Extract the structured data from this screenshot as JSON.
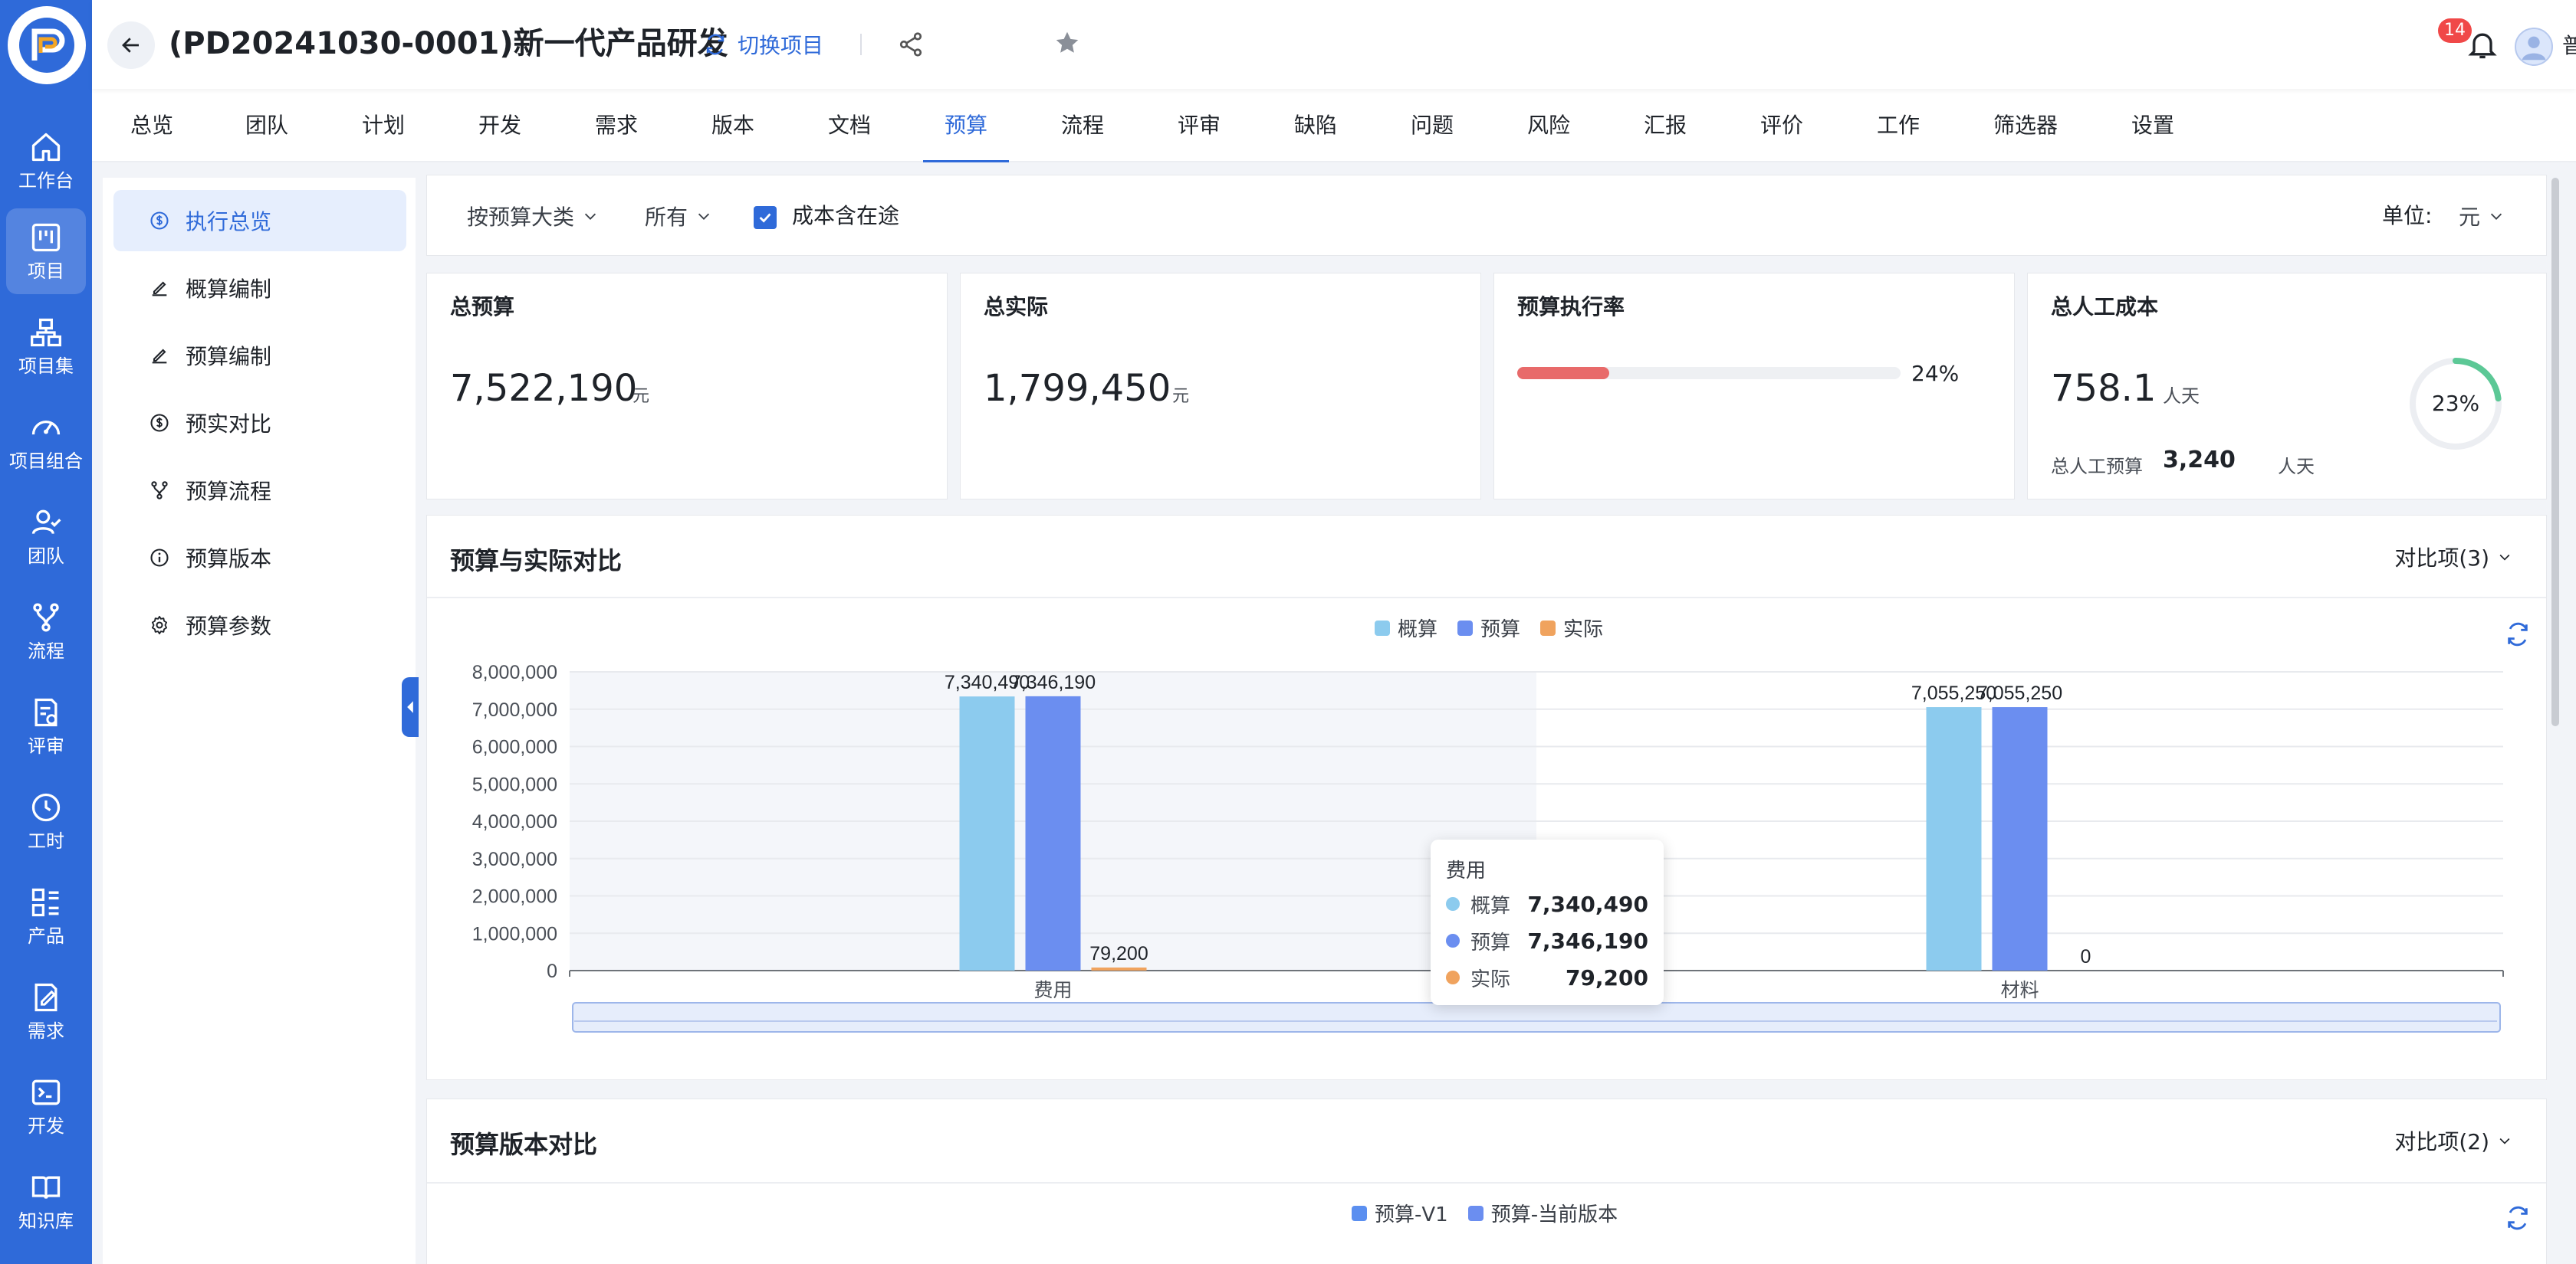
{
  "nav": {
    "items": [
      {
        "label": "工作台",
        "icon": "home-icon"
      },
      {
        "label": "项目",
        "icon": "kanban-icon"
      },
      {
        "label": "项目集",
        "icon": "hierarchy-icon"
      },
      {
        "label": "项目组合",
        "icon": "gauge-icon"
      },
      {
        "label": "团队",
        "icon": "team-icon"
      },
      {
        "label": "流程",
        "icon": "flow-icon"
      },
      {
        "label": "评审",
        "icon": "review-icon"
      },
      {
        "label": "工时",
        "icon": "clock-icon"
      },
      {
        "label": "产品",
        "icon": "product-icon"
      },
      {
        "label": "需求",
        "icon": "requirement-icon"
      },
      {
        "label": "开发",
        "icon": "terminal-icon"
      },
      {
        "label": "知识库",
        "icon": "book-icon"
      }
    ],
    "active_index": 1
  },
  "header": {
    "title": "(PD20241030-0001)新一代产品研发",
    "switch_label": "切换项目",
    "notification_count": "14",
    "user_name": "普明"
  },
  "tabs": {
    "items": [
      "总览",
      "团队",
      "计划",
      "开发",
      "需求",
      "版本",
      "文档",
      "预算",
      "流程",
      "评审",
      "缺陷",
      "问题",
      "风险",
      "汇报",
      "评价",
      "工作",
      "筛选器",
      "设置"
    ],
    "active_index": 7
  },
  "subnav": {
    "items": [
      {
        "label": "执行总览",
        "icon": "dollar-circle-icon"
      },
      {
        "label": "概算编制",
        "icon": "edit-icon"
      },
      {
        "label": "预算编制",
        "icon": "edit-icon"
      },
      {
        "label": "预实对比",
        "icon": "dollar-circle-icon"
      },
      {
        "label": "预算流程",
        "icon": "branch-icon"
      },
      {
        "label": "预算版本",
        "icon": "info-circle-icon"
      },
      {
        "label": "预算参数",
        "icon": "gear-icon"
      }
    ],
    "active_index": 0
  },
  "filters": {
    "group_by": "按预算大类",
    "scope": "所有",
    "cost_in_transit": "成本含在途",
    "cost_in_transit_checked": true,
    "unit_label": "单位:",
    "unit_value": "元"
  },
  "cards": {
    "total_budget": {
      "title": "总预算",
      "value": "7,522,190",
      "unit": "元"
    },
    "total_actual": {
      "title": "总实际",
      "value": "1,799,450",
      "unit": "元"
    },
    "execution_rate": {
      "title": "预算执行率",
      "value": "24%",
      "fraction": 0.24
    },
    "labor_cost": {
      "title": "总人工成本",
      "value": "758.1",
      "unit": "人天",
      "budget_label": "总人工预算",
      "budget_value": "3,240",
      "budget_unit": "人天",
      "ring_value": "23%",
      "ring_fraction": 0.23
    }
  },
  "budget_vs_actual": {
    "title": "预算与实际对比",
    "compare_label": "对比项(3)",
    "legend": [
      {
        "name": "概算",
        "color": "#8ccbee"
      },
      {
        "name": "预算",
        "color": "#6b8ef0"
      },
      {
        "name": "实际",
        "color": "#f0a35e"
      }
    ],
    "tooltip": {
      "title": "费用",
      "rows": [
        {
          "name": "概算",
          "value": "7,340,490",
          "color": "#8ccbee"
        },
        {
          "name": "预算",
          "value": "7,346,190",
          "color": "#6b8ef0"
        },
        {
          "name": "实际",
          "value": "79,200",
          "color": "#f0a35e"
        }
      ]
    }
  },
  "version_compare": {
    "title": "预算版本对比",
    "compare_label": "对比项(2)",
    "legend": [
      {
        "name": "预算-V1",
        "color": "#5b8ff0"
      },
      {
        "name": "预算-当前版本",
        "color": "#6b8ef0"
      }
    ]
  },
  "chart_data": {
    "type": "bar",
    "categories": [
      "费用",
      "材料"
    ],
    "series": [
      {
        "name": "概算",
        "values": [
          7340490,
          7055250
        ]
      },
      {
        "name": "预算",
        "values": [
          7346190,
          7055250
        ]
      },
      {
        "name": "实际",
        "values": [
          79200,
          0
        ]
      }
    ],
    "value_labels": [
      [
        "7,340,490",
        "7,055,250"
      ],
      [
        "7,346,190",
        "7,055,250"
      ],
      [
        "79,200",
        "0"
      ]
    ],
    "y_ticks": [
      "0",
      "1,000,000",
      "2,000,000",
      "3,000,000",
      "4,000,000",
      "5,000,000",
      "6,000,000",
      "7,000,000",
      "8,000,000"
    ],
    "ylim": [
      0,
      8000000
    ],
    "colors": [
      "#8ccbee",
      "#6b8ef0",
      "#f0a35e"
    ],
    "grid": true,
    "legend": "top-center",
    "highlighted_category": "费用"
  }
}
